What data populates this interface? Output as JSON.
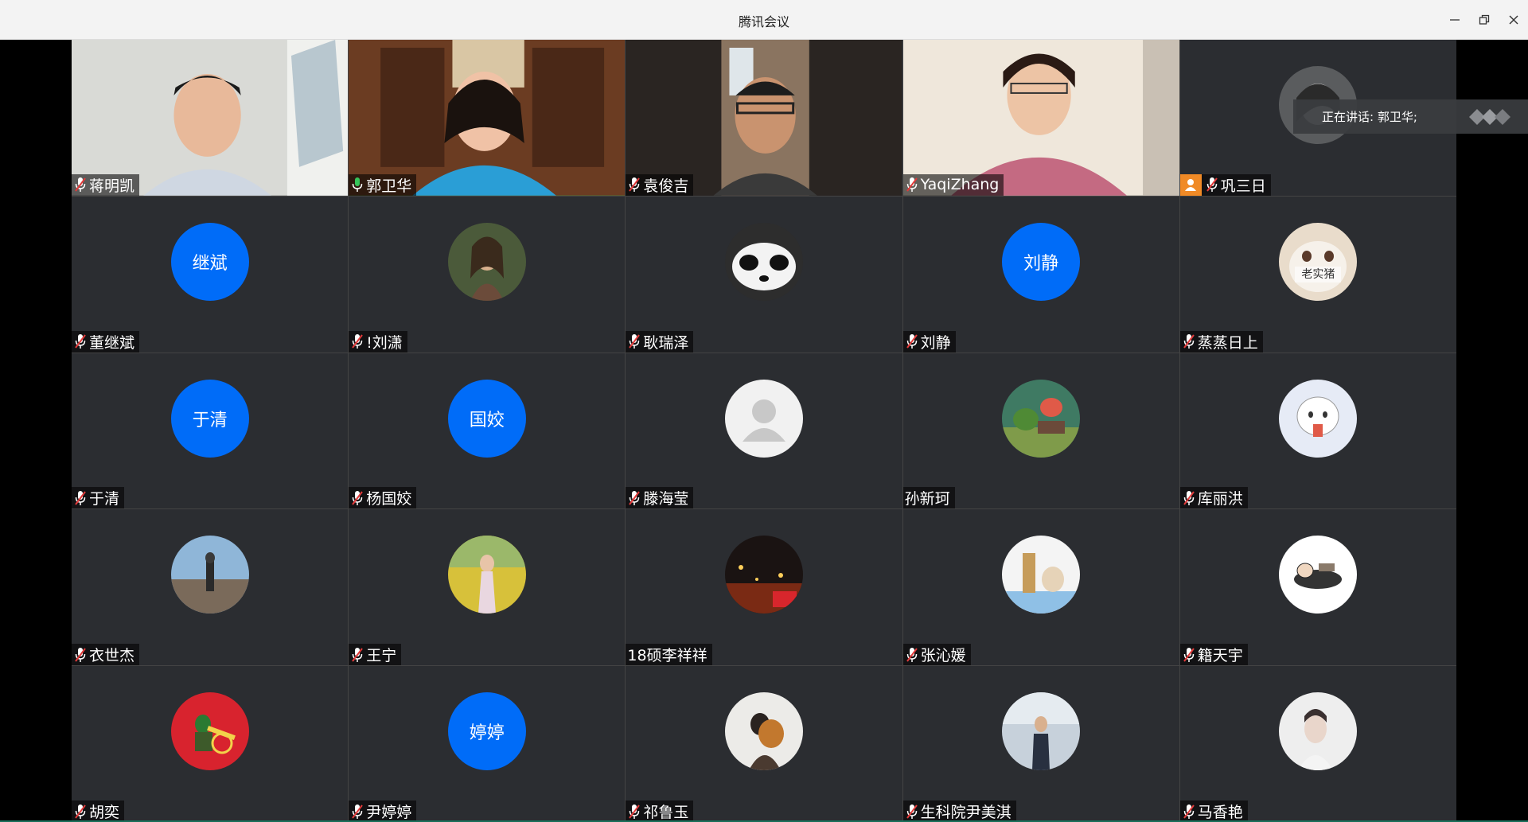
{
  "window": {
    "title": "腾讯会议",
    "controls": [
      "minimize-icon",
      "restore-icon",
      "close-icon"
    ]
  },
  "speaking_banner": {
    "text": "正在讲话: 郭卫华;"
  },
  "accent_colors": {
    "avatar_blue": "#006cf8",
    "active_speaker": "#36c55a",
    "host_badge": "#f08a26",
    "muted_red": "#e23b3b"
  },
  "participants": [
    {
      "name": "蒋明凯",
      "mic": "muted",
      "media": "video"
    },
    {
      "name": "郭卫华",
      "mic": "on",
      "media": "video",
      "active": true
    },
    {
      "name": "袁俊吉",
      "mic": "muted",
      "media": "video"
    },
    {
      "name": "YaqiZhang",
      "mic": "muted",
      "media": "video"
    },
    {
      "name": "巩三日",
      "mic": "muted",
      "media": "avatar",
      "host": true
    },
    {
      "name": "董继斌",
      "mic": "muted",
      "media": "initials",
      "initials": "继斌"
    },
    {
      "name": "!刘潇",
      "mic": "muted",
      "media": "avatar"
    },
    {
      "name": "耿瑞泽",
      "mic": "muted",
      "media": "avatar"
    },
    {
      "name": "刘静",
      "mic": "muted",
      "media": "initials",
      "initials": "刘静"
    },
    {
      "name": "蒸蒸日上",
      "mic": "muted",
      "media": "avatar",
      "avatar_text": "老实猪"
    },
    {
      "name": "于清",
      "mic": "muted",
      "media": "initials",
      "initials": "于清"
    },
    {
      "name": "杨国姣",
      "mic": "muted",
      "media": "initials",
      "initials": "国姣"
    },
    {
      "name": "滕海莹",
      "mic": "muted",
      "media": "default-avatar"
    },
    {
      "name": "孙新珂",
      "mic": "none",
      "media": "avatar"
    },
    {
      "name": "库丽洪",
      "mic": "muted",
      "media": "avatar"
    },
    {
      "name": "衣世杰",
      "mic": "muted",
      "media": "avatar"
    },
    {
      "name": "王宁",
      "mic": "muted",
      "media": "avatar"
    },
    {
      "name": "18硕李祥祥",
      "mic": "none",
      "media": "avatar"
    },
    {
      "name": "张沁媛",
      "mic": "muted",
      "media": "avatar"
    },
    {
      "name": "籍天宇",
      "mic": "muted",
      "media": "avatar"
    },
    {
      "name": "胡奕",
      "mic": "muted",
      "media": "avatar"
    },
    {
      "name": "尹婷婷",
      "mic": "muted",
      "media": "initials",
      "initials": "婷婷"
    },
    {
      "name": "祁鲁玉",
      "mic": "muted",
      "media": "avatar"
    },
    {
      "name": "生科院尹美淇",
      "mic": "muted",
      "media": "avatar"
    },
    {
      "name": "马香艳",
      "mic": "muted",
      "media": "avatar"
    }
  ]
}
